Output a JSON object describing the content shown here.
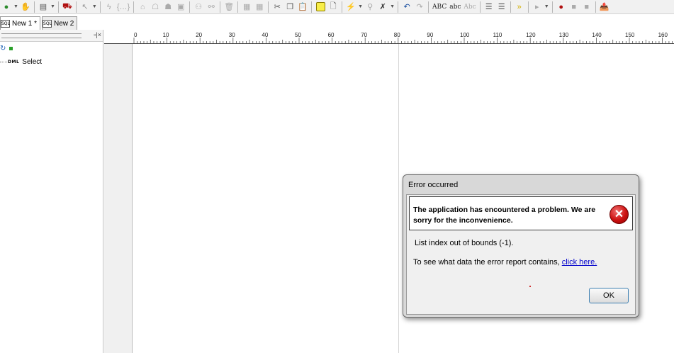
{
  "tabs": [
    {
      "label": "New 1 *",
      "icon": "sql-file-icon",
      "active": true
    },
    {
      "label": "New 2",
      "icon": "sql-file-icon",
      "active": false
    }
  ],
  "toolbar": {
    "spellcheck_upper": "ABC",
    "spellcheck_lower": "abc",
    "spellcheck_mixed": "Abc",
    "icons": [
      "connect-icon",
      "hand-icon",
      "query-icon",
      "car-icon",
      "pointer-icon",
      "lightning-icon",
      "brackets-icon",
      "cut-icon",
      "copy-icon",
      "paste-icon",
      "notebook-icon",
      "new-page-icon",
      "undo-icon",
      "redo-icon",
      "indent-icon",
      "outdent-icon",
      "fast-forward-icon",
      "play-icon",
      "record-icon",
      "stop-icon",
      "export-icon"
    ]
  },
  "left_panel": {
    "header_buttons": "▫|×",
    "tree": [
      {
        "tag": "DML",
        "label": "Select"
      }
    ]
  },
  "ruler": {
    "ticks": [
      "0",
      "10",
      "20",
      "30",
      "40",
      "50",
      "60",
      "70",
      "80",
      "90",
      "100",
      "110",
      "120",
      "130",
      "140",
      "150",
      "160"
    ]
  },
  "dialog": {
    "title": "Error occurred",
    "heading": "The application has encountered a problem. We are sorry for the inconvenience.",
    "message": "List index out of bounds (-1).",
    "report_text": "To see what data the error report contains,",
    "report_link": "click here.",
    "ok_label": "OK",
    "icon": "error-x-icon"
  },
  "colors": {
    "link": "#0000cc",
    "error_red": "#cc1010",
    "button_border": "#3c7fb1"
  }
}
